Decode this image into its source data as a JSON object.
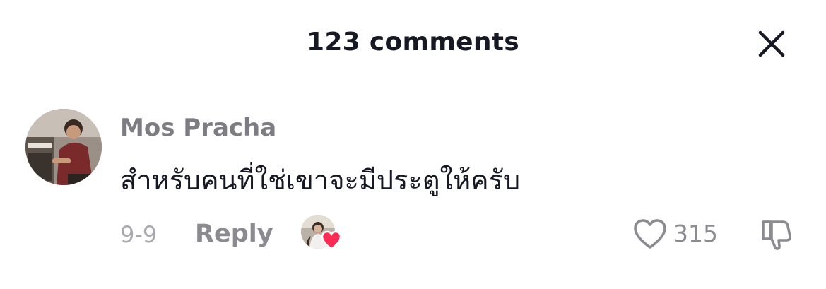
{
  "header": {
    "title": "123 comments",
    "close_icon": "close-icon"
  },
  "comment": {
    "username": "Mos Pracha",
    "text": "สำหรับคนที่ใช่เขาจะมีประตูให้ครับ",
    "date": "9-9",
    "reply_label": "Reply",
    "like_count": "315",
    "icons": {
      "like": "heart-outline-icon",
      "dislike": "thumbs-down-icon",
      "creator_liked": "heart-filled-icon"
    }
  },
  "colors": {
    "primary_text": "#161823",
    "secondary_text": "#8a8a90",
    "muted_text": "#a8a8ae",
    "liked_heart": "#fe2c55"
  }
}
